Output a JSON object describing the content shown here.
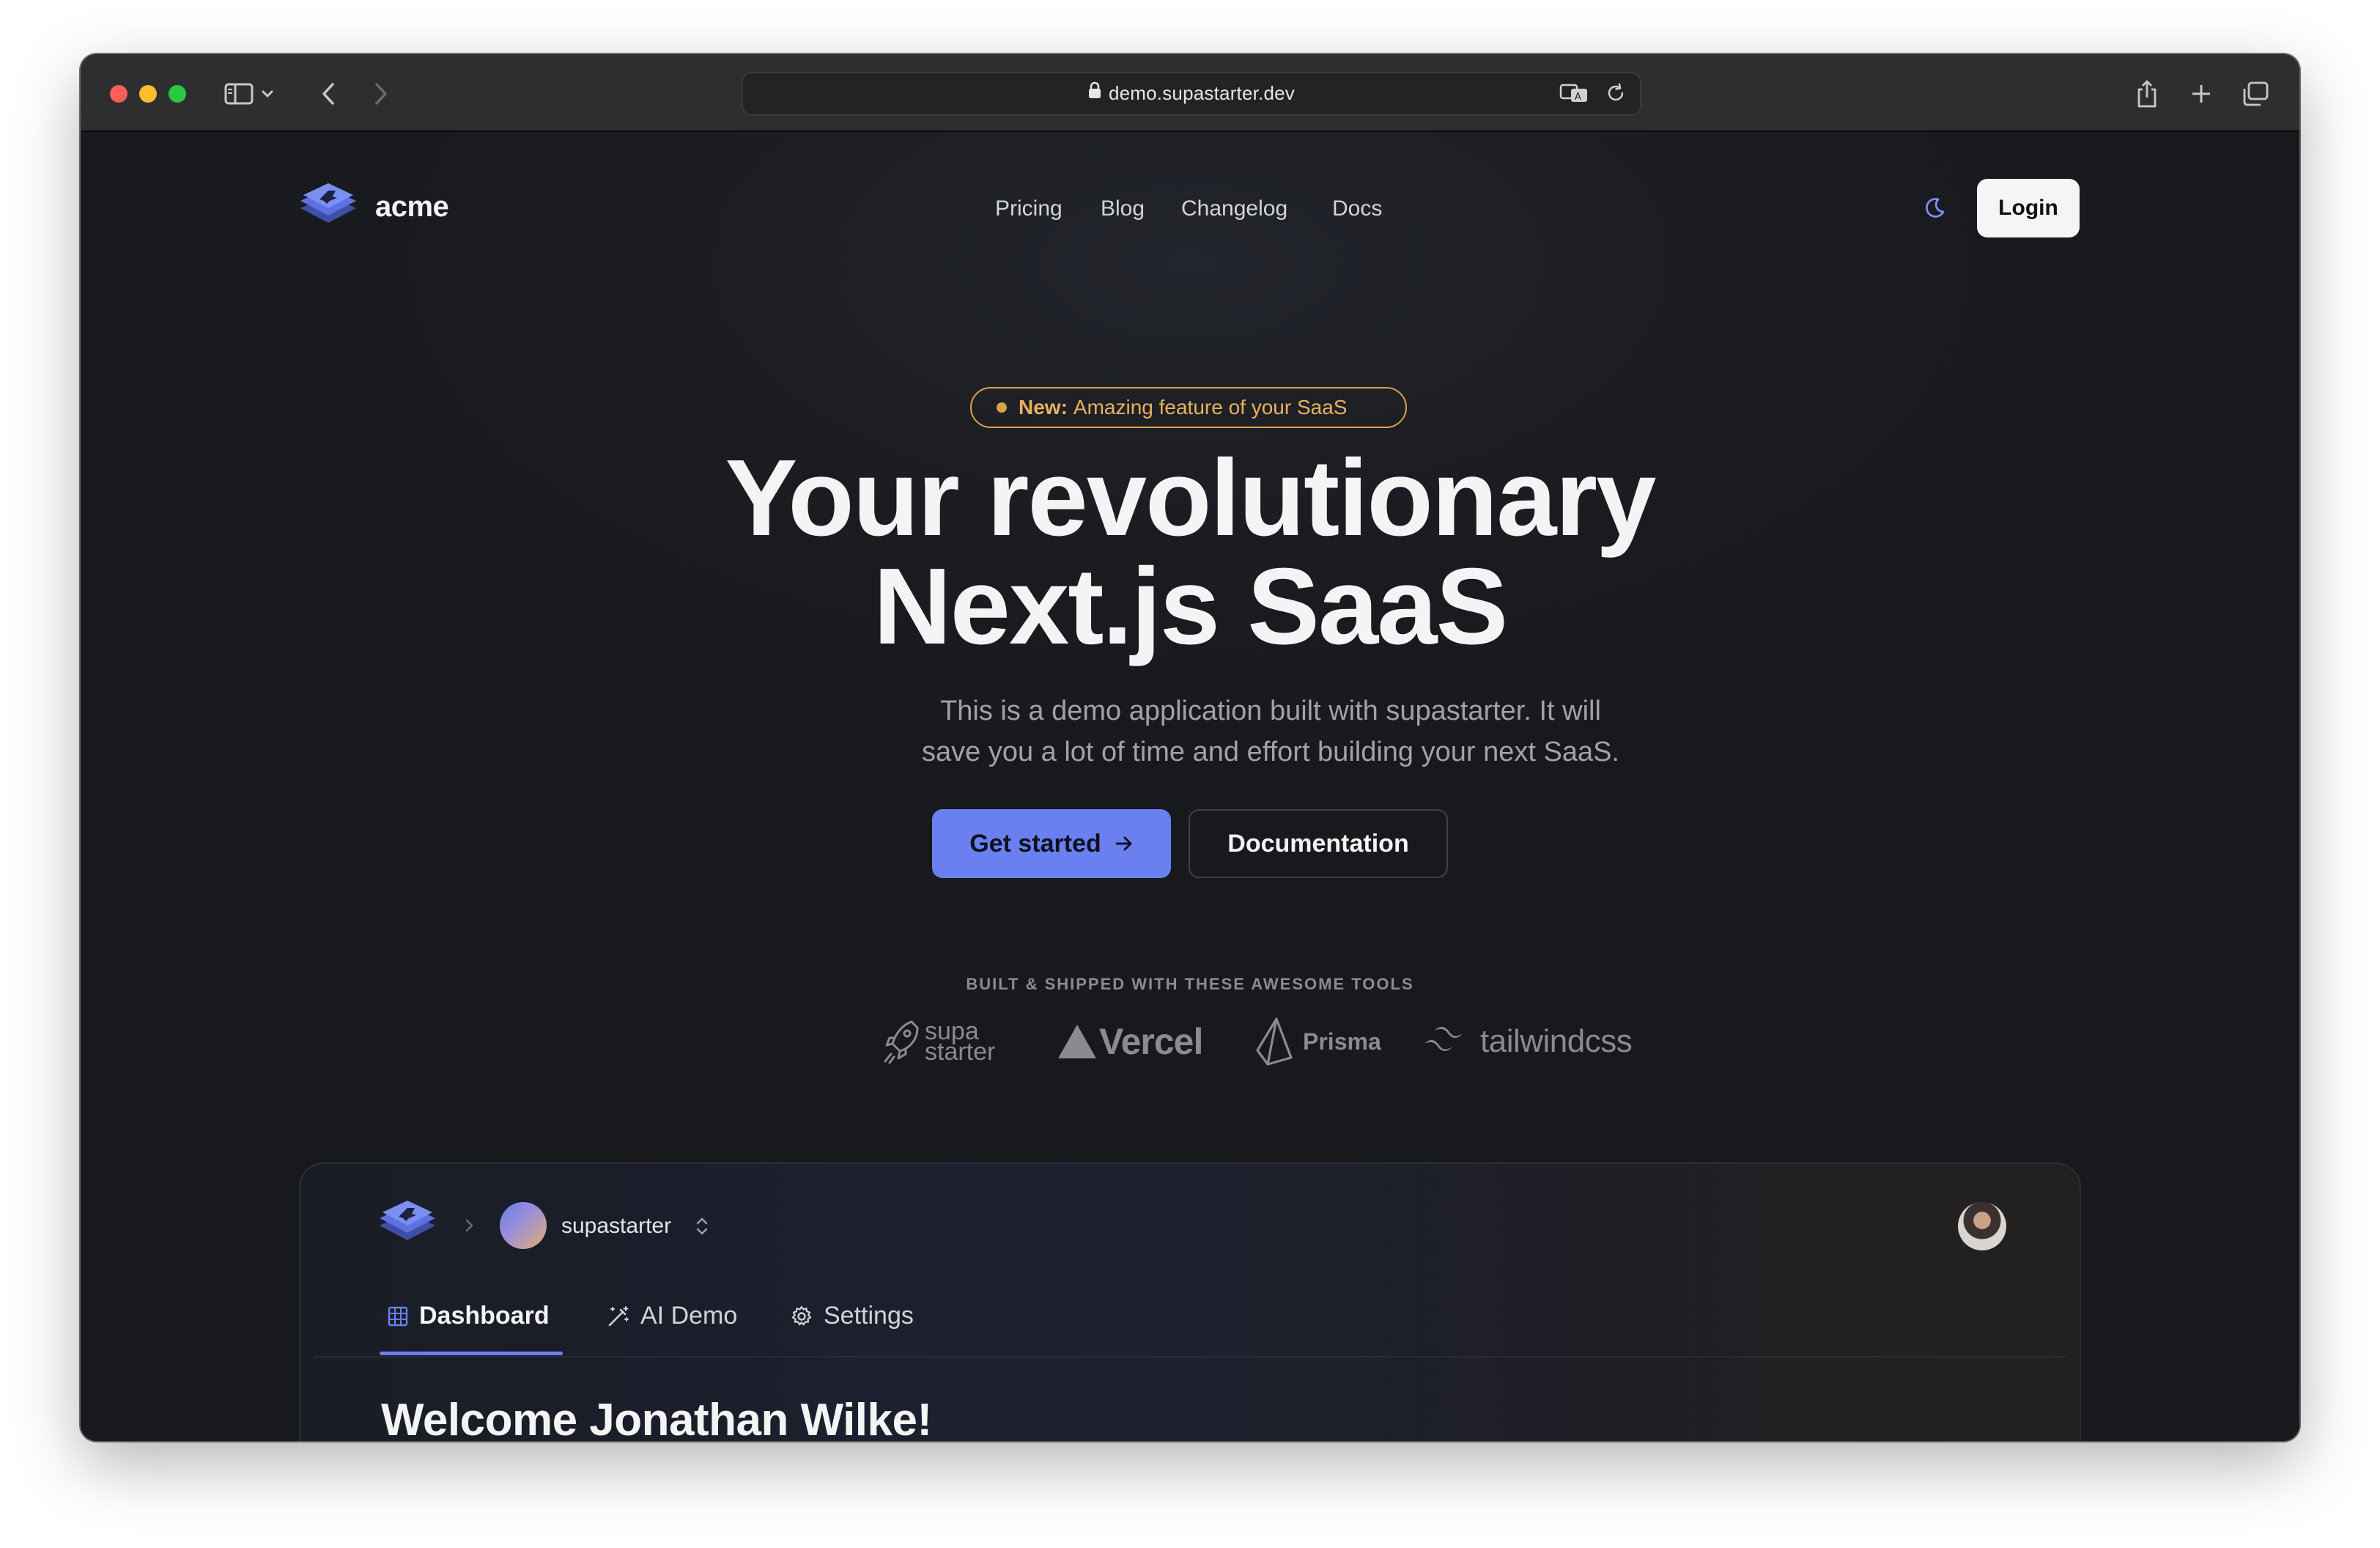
{
  "browser": {
    "url": "demo.supastarter.dev"
  },
  "brand": {
    "name": "acme",
    "accent": "#6b80f0"
  },
  "nav": {
    "items": [
      "Pricing",
      "Blog",
      "Changelog",
      "Docs"
    ],
    "login_label": "Login"
  },
  "hero": {
    "badge_strong": "New:",
    "badge_text": "Amazing feature of your SaaS",
    "title_line1": "Your revolutionary",
    "title_line2": "Next.js SaaS",
    "subtitle_line1": "This is a demo application built with supastarter. It will",
    "subtitle_line2": "save you a lot of time and effort building your next SaaS.",
    "cta_primary": "Get started",
    "cta_secondary": "Documentation"
  },
  "tools": {
    "label": "BUILT & SHIPPED WITH THESE AWESOME TOOLS",
    "supa_line1": "supa",
    "supa_line2": "starter",
    "vercel": "Vercel",
    "prisma": "Prisma",
    "tailwind": "tailwindcss"
  },
  "mockup": {
    "org_name": "supastarter",
    "tabs": [
      "Dashboard",
      "AI Demo",
      "Settings"
    ],
    "welcome": "Welcome Jonathan Wilke!"
  }
}
